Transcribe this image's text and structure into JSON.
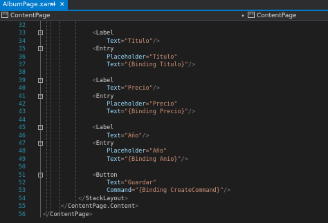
{
  "tab": {
    "title": "AlbumPage.xaml",
    "pin_glyph": "⇔",
    "close_glyph": "✕"
  },
  "navbar": {
    "left_label": "ContentPage",
    "right_label": "ContentPage",
    "dropdown_glyph": "▾"
  },
  "colors": {
    "line_number": "#2b91af",
    "punctuation": "#808080",
    "tag": "#d4d4d4",
    "attribute": "#9cdcfe",
    "value": "#ce9178",
    "accent": "#007acc",
    "background": "#1e1e1e"
  },
  "editor": {
    "lines": [
      {
        "number": "32",
        "indent": 0,
        "fold": false,
        "tokens": []
      },
      {
        "number": "33",
        "indent": 14,
        "fold": true,
        "tokens": [
          {
            "t": "<",
            "k": "punc"
          },
          {
            "t": "Label",
            "k": "tag"
          }
        ]
      },
      {
        "number": "34",
        "indent": 18,
        "fold": false,
        "tokens": [
          {
            "t": "Text",
            "k": "attr"
          },
          {
            "t": "=\"Título\"",
            "k": "val"
          },
          {
            "t": "/>",
            "k": "punc"
          }
        ]
      },
      {
        "number": "35",
        "indent": 14,
        "fold": true,
        "tokens": [
          {
            "t": "<",
            "k": "punc"
          },
          {
            "t": "Entry",
            "k": "tag"
          }
        ]
      },
      {
        "number": "36",
        "indent": 18,
        "fold": false,
        "tokens": [
          {
            "t": "Placeholder",
            "k": "attr"
          },
          {
            "t": "=\"Título\"",
            "k": "val"
          }
        ]
      },
      {
        "number": "37",
        "indent": 18,
        "fold": false,
        "tokens": [
          {
            "t": "Text",
            "k": "attr"
          },
          {
            "t": "=\"{Binding Título}\"",
            "k": "val"
          },
          {
            "t": "/>",
            "k": "punc"
          }
        ]
      },
      {
        "number": "38",
        "indent": 0,
        "fold": false,
        "tokens": []
      },
      {
        "number": "39",
        "indent": 14,
        "fold": true,
        "tokens": [
          {
            "t": "<",
            "k": "punc"
          },
          {
            "t": "Label",
            "k": "tag"
          }
        ]
      },
      {
        "number": "40",
        "indent": 18,
        "fold": false,
        "tokens": [
          {
            "t": "Text",
            "k": "attr"
          },
          {
            "t": "=\"Precio\"",
            "k": "val"
          },
          {
            "t": "/>",
            "k": "punc"
          }
        ]
      },
      {
        "number": "41",
        "indent": 14,
        "fold": true,
        "tokens": [
          {
            "t": "<",
            "k": "punc"
          },
          {
            "t": "Entry",
            "k": "tag"
          }
        ]
      },
      {
        "number": "42",
        "indent": 18,
        "fold": false,
        "tokens": [
          {
            "t": "Placeholder",
            "k": "attr"
          },
          {
            "t": "=\"Precio\"",
            "k": "val"
          }
        ]
      },
      {
        "number": "43",
        "indent": 18,
        "fold": false,
        "tokens": [
          {
            "t": "Text",
            "k": "attr"
          },
          {
            "t": "=\"{Binding Precio}\"",
            "k": "val"
          },
          {
            "t": "/>",
            "k": "punc"
          }
        ]
      },
      {
        "number": "44",
        "indent": 0,
        "fold": false,
        "tokens": []
      },
      {
        "number": "45",
        "indent": 14,
        "fold": true,
        "tokens": [
          {
            "t": "<",
            "k": "punc"
          },
          {
            "t": "Label",
            "k": "tag"
          }
        ]
      },
      {
        "number": "46",
        "indent": 18,
        "fold": false,
        "tokens": [
          {
            "t": "Text",
            "k": "attr"
          },
          {
            "t": "=\"Año\"",
            "k": "val"
          },
          {
            "t": "/>",
            "k": "punc"
          }
        ]
      },
      {
        "number": "47",
        "indent": 14,
        "fold": true,
        "tokens": [
          {
            "t": "<",
            "k": "punc"
          },
          {
            "t": "Entry",
            "k": "tag"
          }
        ]
      },
      {
        "number": "48",
        "indent": 18,
        "fold": false,
        "tokens": [
          {
            "t": "Placeholder",
            "k": "attr"
          },
          {
            "t": "=\"Año\"",
            "k": "val"
          }
        ]
      },
      {
        "number": "49",
        "indent": 18,
        "fold": false,
        "tokens": [
          {
            "t": "Text",
            "k": "attr"
          },
          {
            "t": "=\"{Binding Anio}\"",
            "k": "val"
          },
          {
            "t": "/>",
            "k": "punc"
          }
        ]
      },
      {
        "number": "50",
        "indent": 0,
        "fold": false,
        "tokens": []
      },
      {
        "number": "51",
        "indent": 14,
        "fold": true,
        "tokens": [
          {
            "t": "<",
            "k": "punc"
          },
          {
            "t": "Button",
            "k": "tag"
          }
        ]
      },
      {
        "number": "52",
        "indent": 18,
        "fold": false,
        "tokens": [
          {
            "t": "Text",
            "k": "attr"
          },
          {
            "t": "=\"Guardar\"",
            "k": "val"
          }
        ]
      },
      {
        "number": "53",
        "indent": 18,
        "fold": false,
        "tokens": [
          {
            "t": "Command",
            "k": "attr"
          },
          {
            "t": "=\"{Binding CreateCommand}\"",
            "k": "val"
          },
          {
            "t": "/>",
            "k": "punc"
          }
        ]
      },
      {
        "number": "54",
        "indent": 10,
        "fold": false,
        "tokens": [
          {
            "t": "</",
            "k": "punc"
          },
          {
            "t": "StackLayout",
            "k": "tag"
          },
          {
            "t": ">",
            "k": "punc"
          }
        ]
      },
      {
        "number": "55",
        "indent": 5,
        "fold": false,
        "tokens": [
          {
            "t": "</",
            "k": "punc"
          },
          {
            "t": "ContentPage.Content",
            "k": "tag"
          },
          {
            "t": ">",
            "k": "punc"
          }
        ]
      },
      {
        "number": "56",
        "indent": 0,
        "fold": false,
        "tokens": [
          {
            "t": "</",
            "k": "punc"
          },
          {
            "t": "ContentPage",
            "k": "tag"
          },
          {
            "t": ">",
            "k": "punc"
          }
        ]
      }
    ]
  }
}
